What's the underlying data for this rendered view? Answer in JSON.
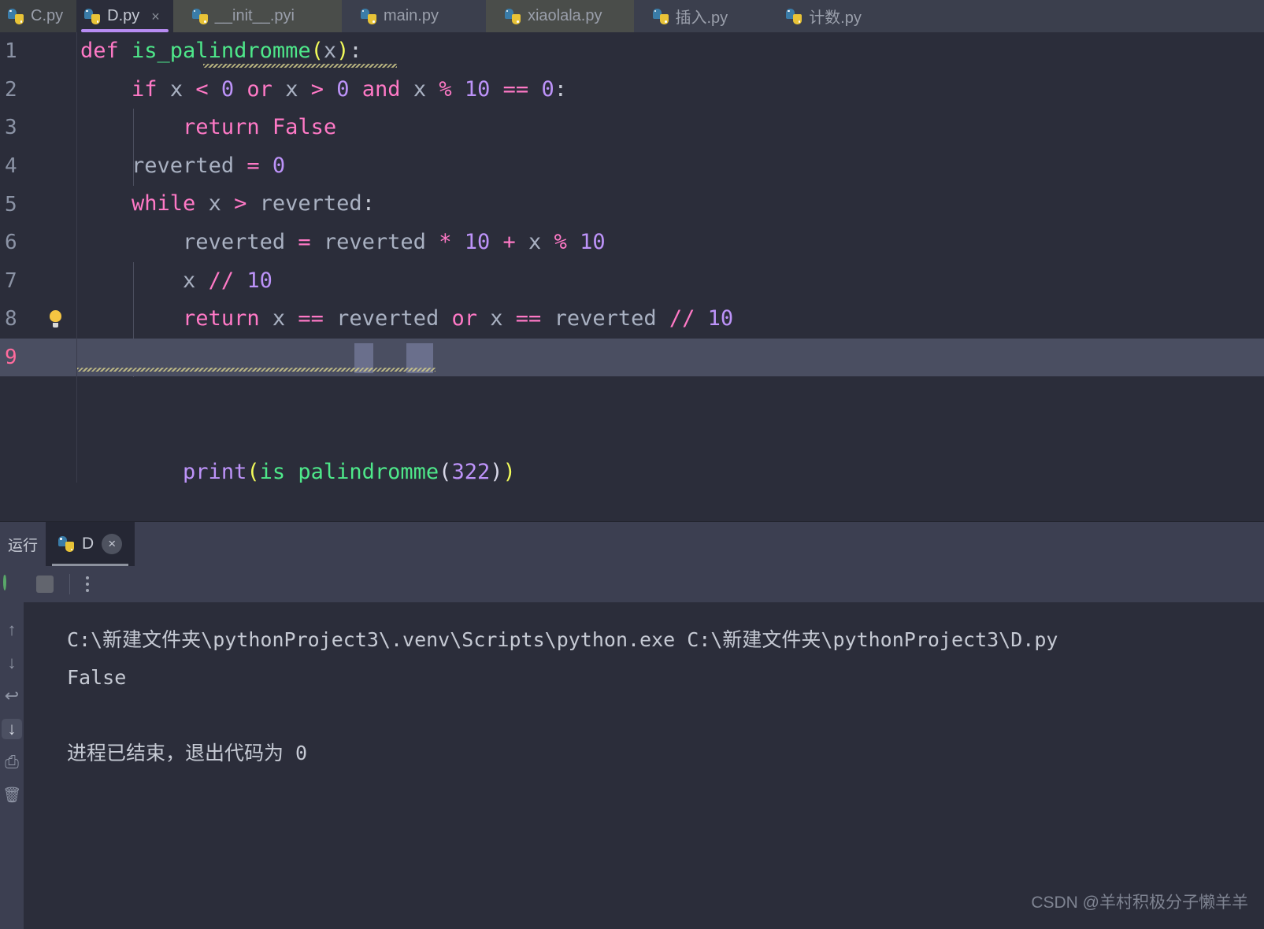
{
  "colors": {
    "editor_bg": "#2b2d3a",
    "tabbar_bg": "#3c3f41",
    "active_tab_accent": "#b78cf2",
    "keyword": "#ff79c6",
    "function": "#4ee88a",
    "number": "#bd93f9",
    "variable": "#a9b1c2",
    "bracket": "#f1fa5a",
    "current_line": "#4a4e61",
    "console_bg": "#2b2d3a",
    "run_panel_bg": "#3c3f51"
  },
  "tabbar": {
    "tabs": [
      {
        "label": "C.py",
        "icon": "python-file-icon",
        "active": false,
        "closable": false
      },
      {
        "label": "D.py",
        "icon": "python-file-icon",
        "active": true,
        "closable": true,
        "close_glyph": "×"
      },
      {
        "label": "__init__.pyi",
        "icon": "python-file-icon",
        "active": false,
        "closable": false
      },
      {
        "label": "main.py",
        "icon": "python-file-icon",
        "active": false,
        "closable": false
      },
      {
        "label": "xiaolala.py",
        "icon": "python-file-icon",
        "active": false,
        "closable": false
      },
      {
        "label": "插入.py",
        "icon": "python-file-icon",
        "active": false,
        "closable": false
      },
      {
        "label": "计数.py",
        "icon": "python-file-icon",
        "active": false,
        "closable": false
      }
    ]
  },
  "editor": {
    "line_numbers": [
      "1",
      "2",
      "3",
      "4",
      "5",
      "6",
      "7",
      "8",
      "9"
    ],
    "current_line_number": "9",
    "bulb_line": "8",
    "bulb_icon": "lightbulb-icon",
    "lines": [
      {
        "n": "1",
        "text": "def is_palindromme(x):"
      },
      {
        "n": "2",
        "text": "    if x < 0 or x > 0 and x % 10 == 0:"
      },
      {
        "n": "3",
        "text": "        return False"
      },
      {
        "n": "4",
        "text": "    reverted = 0"
      },
      {
        "n": "5",
        "text": "    while x > reverted:"
      },
      {
        "n": "6",
        "text": "        reverted = reverted * 10 + x % 10"
      },
      {
        "n": "7",
        "text": "        x // 10"
      },
      {
        "n": "8",
        "text": "        return x == reverted or x == reverted // 10"
      },
      {
        "n": "9",
        "text": "print(is_palindromme(322))"
      }
    ],
    "tokens": {
      "l1": [
        "def ",
        "is_palindromme",
        "(",
        "x",
        ")",
        ":"
      ],
      "l2_kw_if": "if",
      "l2_kw_or": "or",
      "l2_kw_and": "and",
      "l3_kw_return": "return",
      "l3_false": "False",
      "l4_name": "reverted",
      "l4_eq": "=",
      "l4_zero": "0",
      "l5_kw_while": "while",
      "l9_print": "print",
      "l9_fn": "is_palindromme",
      "l9_arg": "322"
    },
    "selection_text": "(322)"
  },
  "run_panel": {
    "panel_label": "运行",
    "tab_label": "D",
    "tab_icon": "python-file-icon",
    "close_glyph": "×",
    "toolbar": {
      "rerun": "rerun-icon",
      "stop": "stop-icon",
      "more": "more-options-icon"
    },
    "sidebar_icons": [
      {
        "name": "scroll-up-icon",
        "glyph": "↑",
        "selected": false
      },
      {
        "name": "scroll-down-icon",
        "glyph": "↓",
        "selected": false
      },
      {
        "name": "soft-wrap-icon",
        "glyph": "↩",
        "selected": false
      },
      {
        "name": "scroll-to-end-icon",
        "glyph": "↓",
        "selected": true
      },
      {
        "name": "print-icon",
        "glyph": "⎙",
        "selected": false
      },
      {
        "name": "trash-icon",
        "glyph": "🗑",
        "selected": false
      }
    ]
  },
  "console": {
    "lines": [
      "C:\\新建文件夹\\pythonProject3\\.venv\\Scripts\\python.exe C:\\新建文件夹\\pythonProject3\\D.py",
      "False",
      "",
      "",
      "进程已结束，退出代码为 0"
    ],
    "command_line": "C:\\新建文件夹\\pythonProject3\\.venv\\Scripts\\python.exe C:\\新建文件夹\\pythonProject3\\D.py",
    "output": "False",
    "exit_message": "进程已结束，退出代码为 0"
  },
  "watermark": {
    "text": "CSDN @羊村积极分子懒羊羊"
  }
}
